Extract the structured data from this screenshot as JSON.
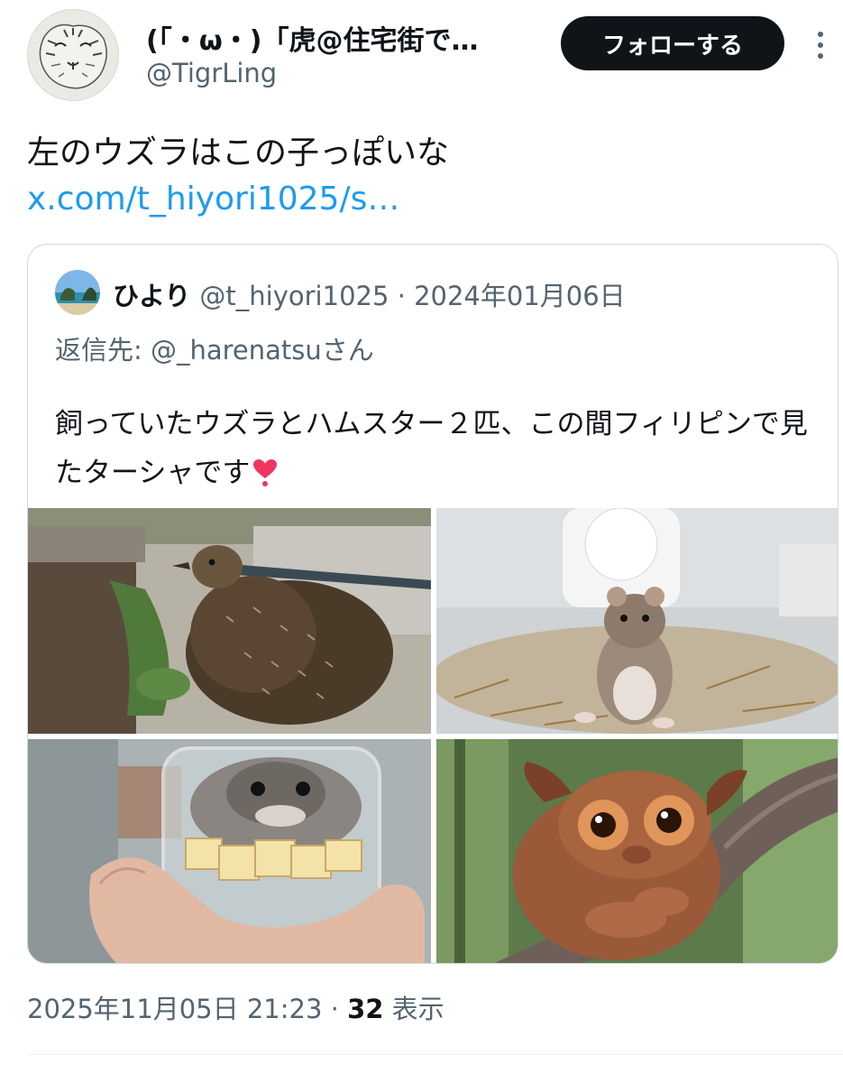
{
  "author": {
    "display_name": "(「・ω・)「虎@住宅街で…",
    "handle": "@TigrLing",
    "avatar_icon": "tiger-sketch-avatar"
  },
  "follow_label": "フォローする",
  "more_icon": "more-vertical-icon",
  "tweet": {
    "text": "左のウズラはこの子っぽいな",
    "link": "x.com/t_hiyori1025/s…"
  },
  "quote": {
    "name": "ひより",
    "meta": "@t_hiyori1025 · 2024年01月06日",
    "reply_to": "返信先: @_harenatsuさん",
    "body": "飼っていたウズラとハムスター２匹、この間フィリピンで見たターシャです",
    "emoji": "heart-exclamation-icon",
    "photos": [
      "quail-photo",
      "hamster-wheel-photo",
      "hamster-jar-photo",
      "tarsier-photo"
    ]
  },
  "timestamp": "2025年11月05日 21:23",
  "separator": " · ",
  "views_count": "32",
  "views_label": " 表示",
  "colors": {
    "text": "#0f1419",
    "secondary": "#536471",
    "link": "#1d9bf0",
    "button_bg": "#0f1419",
    "border": "#cfd9de"
  }
}
